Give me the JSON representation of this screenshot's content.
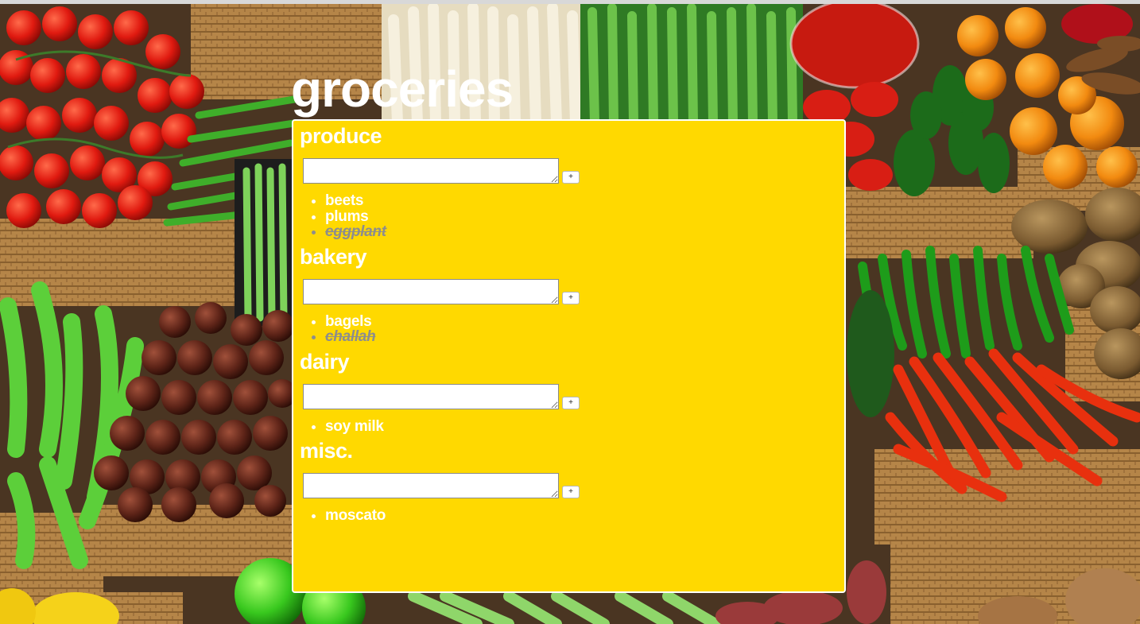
{
  "app": {
    "title": "groceries"
  },
  "add_button_label": "+",
  "colors": {
    "panel": "#ffd900",
    "text": "#ffffff",
    "done_text": "#8d8d8d"
  },
  "sections": [
    {
      "title": "produce",
      "input_value": "",
      "items": [
        {
          "label": "beets",
          "done": false
        },
        {
          "label": "plums",
          "done": false
        },
        {
          "label": "eggplant",
          "done": true
        }
      ]
    },
    {
      "title": "bakery",
      "input_value": "",
      "items": [
        {
          "label": "bagels",
          "done": false
        },
        {
          "label": "challah",
          "done": true
        }
      ]
    },
    {
      "title": "dairy",
      "input_value": "",
      "items": [
        {
          "label": "soy milk",
          "done": false
        }
      ]
    },
    {
      "title": "misc.",
      "input_value": "",
      "items": [
        {
          "label": "moscato",
          "done": false
        }
      ]
    }
  ]
}
